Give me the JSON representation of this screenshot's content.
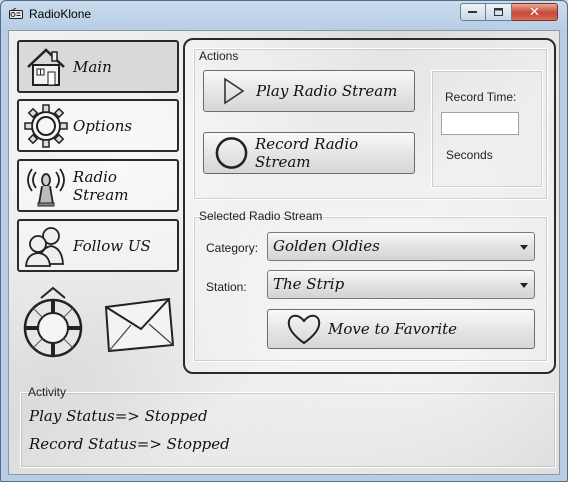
{
  "window": {
    "title": "RadioKlone",
    "minimize_glyph": "▭",
    "maximize_glyph": "□",
    "close_glyph": "✕"
  },
  "nav": {
    "items": [
      {
        "label": "Main",
        "icon": "house-icon",
        "active": true
      },
      {
        "label": "Options",
        "icon": "gear-icon",
        "active": false
      },
      {
        "label": "Radio Stream",
        "icon": "radio-tower-icon",
        "active": false
      },
      {
        "label": "Follow US",
        "icon": "people-icon",
        "active": false
      }
    ],
    "decorations": [
      "lifebuoy-icon",
      "envelope-icon"
    ]
  },
  "actions": {
    "group_label": "Actions",
    "play_label": "Play Radio Stream",
    "record_label": "Record Radio Stream",
    "record_time_label": "Record Time:",
    "record_time_value": "",
    "seconds_label": "Seconds"
  },
  "stream": {
    "group_label": "Selected Radio Stream",
    "category_label": "Category:",
    "category_value": "Golden Oldies",
    "station_label": "Station:",
    "station_value": "The Strip",
    "favorite_label": "Move to Favorite"
  },
  "activity": {
    "group_label": "Activity",
    "play_status": "Play Status=> Stopped",
    "record_status": "Record Status=> Stopped"
  }
}
